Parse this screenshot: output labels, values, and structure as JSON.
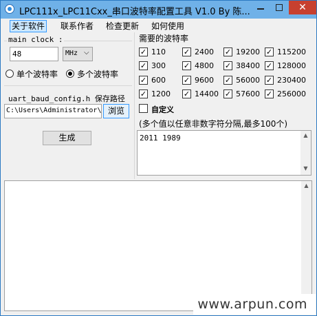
{
  "window": {
    "title": "LPC111x_LPC11Cxx_串口波特率配置工具 V1.0 By 陈...",
    "close_glyph": "✕"
  },
  "menu": [
    "关于软件",
    "联系作者",
    "检查更新",
    "如何使用"
  ],
  "clock": {
    "label": "main clock :",
    "value": "48",
    "unit": "MHz",
    "dropdown_glyph": "⌵"
  },
  "mode": {
    "single": "单个波特率",
    "multi": "多个波特率",
    "selected": "multi"
  },
  "path": {
    "label": "uart_baud_config.h 保存路径",
    "value": "C:\\Users\\Administrator\\",
    "browse": "浏览"
  },
  "generate": "生成",
  "baud": {
    "label": "需要的波特率",
    "rates": [
      [
        "110",
        "2400",
        "19200",
        "115200"
      ],
      [
        "300",
        "4800",
        "38400",
        "128000"
      ],
      [
        "600",
        "9600",
        "56000",
        "230400"
      ],
      [
        "1200",
        "14400",
        "57600",
        "256000"
      ]
    ],
    "check_glyph": "✓",
    "custom_label": "自定义",
    "custom_checked": false,
    "hint": "(多个值以任意非数字符分隔,最多100个)",
    "custom_values": "2011 1989"
  },
  "scroll_glyphs": {
    "up": "▲",
    "down": "▼"
  },
  "watermark": "www.arpun.com"
}
